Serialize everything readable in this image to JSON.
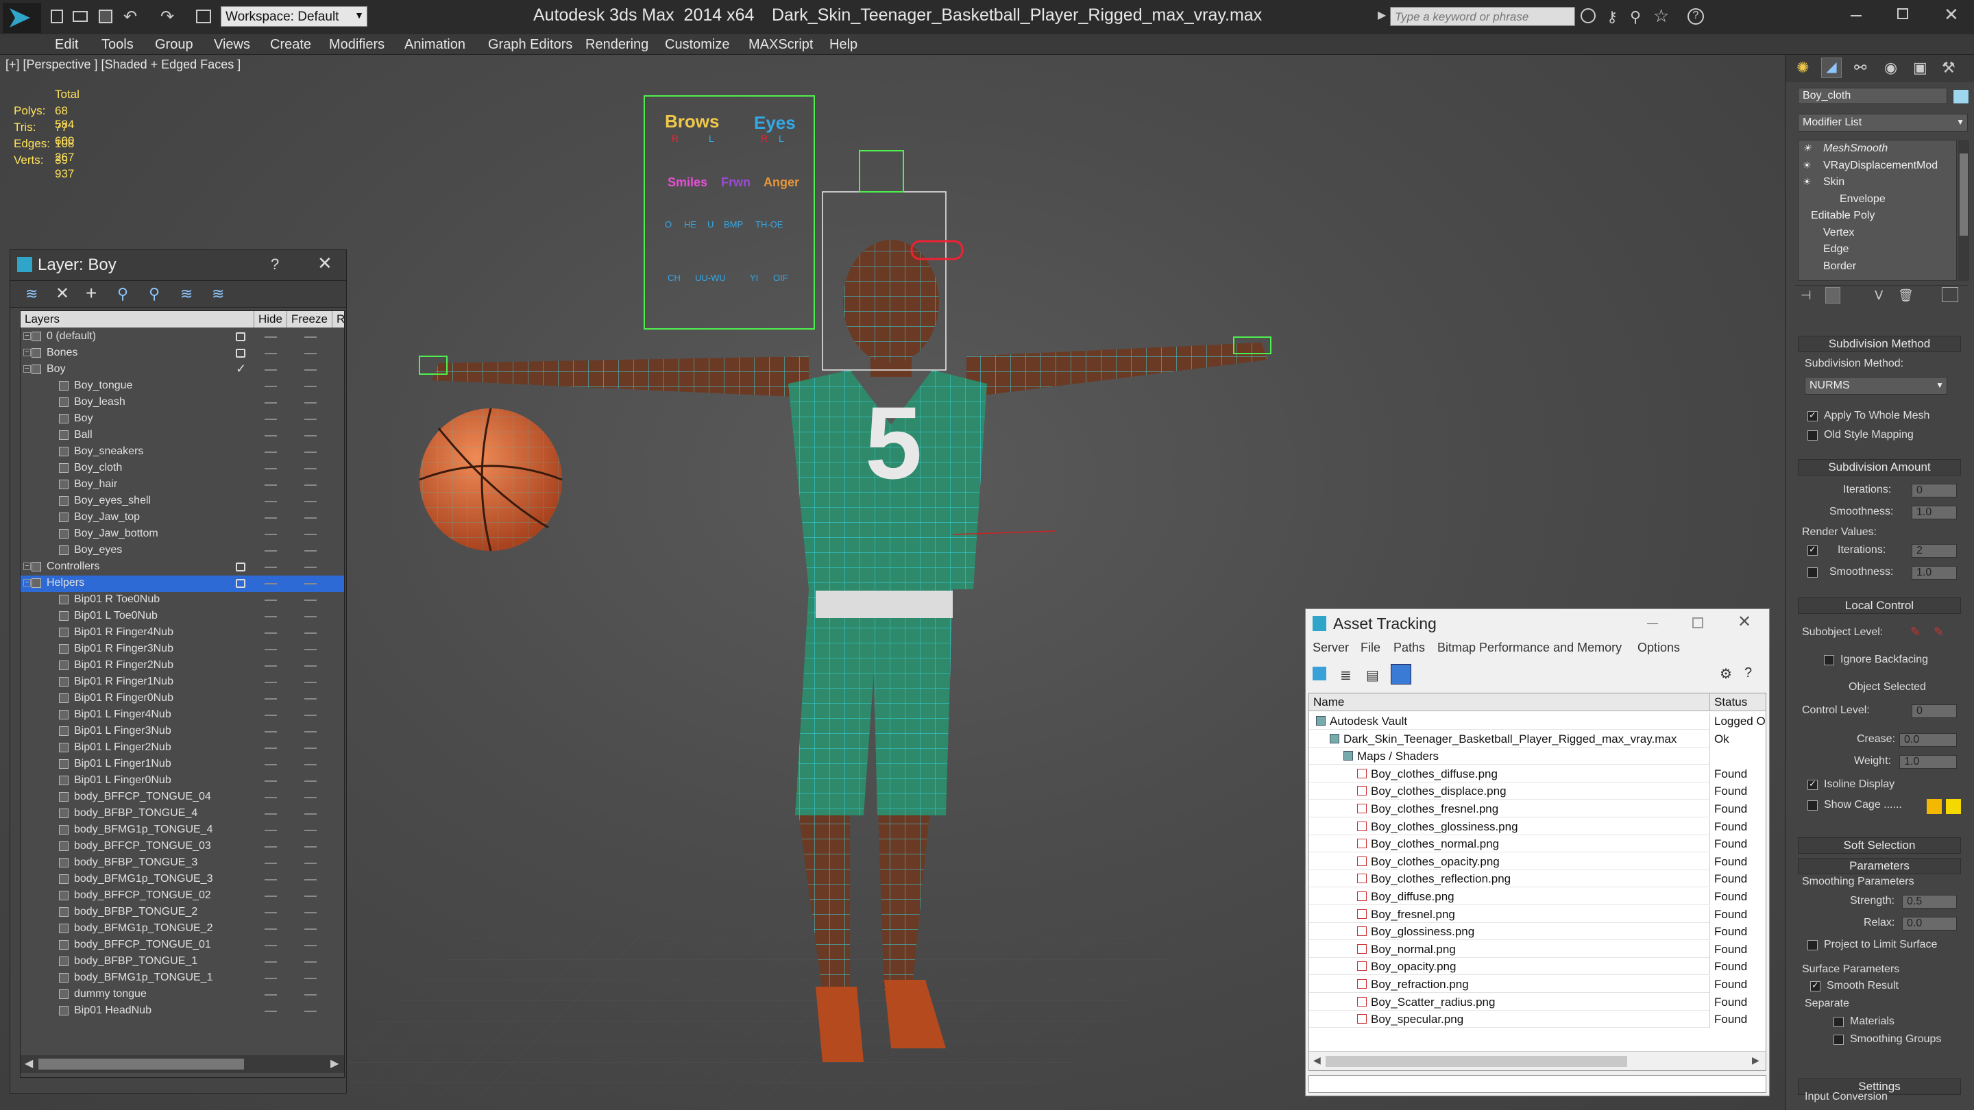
{
  "titlebar": {
    "workspace": "Workspace: Default",
    "app_title": "Autodesk 3ds Max  2014 x64",
    "file_title": "Dark_Skin_Teenager_Basketball_Player_Rigged_max_vray.max",
    "search_placeholder": "Type a keyword or phrase"
  },
  "menu": [
    "Edit",
    "Tools",
    "Group",
    "Views",
    "Create",
    "Modifiers",
    "Animation",
    "Graph Editors",
    "Rendering",
    "Customize",
    "MAXScript",
    "Help"
  ],
  "viewport": {
    "label": "[+] [Perspective ] [Shaded + Edged Faces ]",
    "stats": {
      "header": "Total",
      "rows": [
        {
          "label": "Polys:",
          "value": "68 584"
        },
        {
          "label": "Tris:",
          "value": "77 600"
        },
        {
          "label": "Edges:",
          "value": "108 267"
        },
        {
          "label": "Verts:",
          "value": "39 937"
        }
      ]
    },
    "jersey_number": "5",
    "facial_board": {
      "brows": "Brows",
      "eyes": "Eyes",
      "r1": "R",
      "l1": "L",
      "r2": "R",
      "l2": "L",
      "smiles": "Smiles",
      "frown": "Frwn",
      "anger": "Anger",
      "row3": [
        "O",
        "HE",
        "U",
        "BMP",
        "TH-OE"
      ],
      "row4": [
        "CH",
        "UU-WU",
        "YI",
        "OIF"
      ]
    }
  },
  "layer_panel": {
    "title": "Layer: Boy",
    "help": "?",
    "col_layers": "Layers",
    "col_hide": "Hide",
    "col_freeze": "Freeze",
    "col_r": "R",
    "rows": [
      {
        "name": "0 (default)",
        "kind": "layer",
        "box": true
      },
      {
        "name": "Bones",
        "kind": "layer",
        "box": true
      },
      {
        "name": "Boy",
        "kind": "layer",
        "check": true
      },
      {
        "name": "Boy_tongue",
        "kind": "obj"
      },
      {
        "name": "Boy_leash",
        "kind": "obj"
      },
      {
        "name": "Boy",
        "kind": "obj"
      },
      {
        "name": "Ball",
        "kind": "obj"
      },
      {
        "name": "Boy_sneakers",
        "kind": "obj"
      },
      {
        "name": "Boy_cloth",
        "kind": "obj"
      },
      {
        "name": "Boy_hair",
        "kind": "obj"
      },
      {
        "name": "Boy_eyes_shell",
        "kind": "obj"
      },
      {
        "name": "Boy_Jaw_top",
        "kind": "obj"
      },
      {
        "name": "Boy_Jaw_bottom",
        "kind": "obj"
      },
      {
        "name": "Boy_eyes",
        "kind": "obj"
      },
      {
        "name": "Controllers",
        "kind": "layer",
        "box": true
      },
      {
        "name": "Helpers",
        "kind": "layer",
        "box": true,
        "selected": true
      },
      {
        "name": "Bip01 R Toe0Nub",
        "kind": "obj"
      },
      {
        "name": "Bip01 L Toe0Nub",
        "kind": "obj"
      },
      {
        "name": "Bip01 R Finger4Nub",
        "kind": "obj"
      },
      {
        "name": "Bip01 R Finger3Nub",
        "kind": "obj"
      },
      {
        "name": "Bip01 R Finger2Nub",
        "kind": "obj"
      },
      {
        "name": "Bip01 R Finger1Nub",
        "kind": "obj"
      },
      {
        "name": "Bip01 R Finger0Nub",
        "kind": "obj"
      },
      {
        "name": "Bip01 L Finger4Nub",
        "kind": "obj"
      },
      {
        "name": "Bip01 L Finger3Nub",
        "kind": "obj"
      },
      {
        "name": "Bip01 L Finger2Nub",
        "kind": "obj"
      },
      {
        "name": "Bip01 L Finger1Nub",
        "kind": "obj"
      },
      {
        "name": "Bip01 L Finger0Nub",
        "kind": "obj"
      },
      {
        "name": "body_BFFCP_TONGUE_04",
        "kind": "obj"
      },
      {
        "name": "body_BFBP_TONGUE_4",
        "kind": "obj"
      },
      {
        "name": "body_BFMG1p_TONGUE_4",
        "kind": "obj"
      },
      {
        "name": "body_BFFCP_TONGUE_03",
        "kind": "obj"
      },
      {
        "name": "body_BFBP_TONGUE_3",
        "kind": "obj"
      },
      {
        "name": "body_BFMG1p_TONGUE_3",
        "kind": "obj"
      },
      {
        "name": "body_BFFCP_TONGUE_02",
        "kind": "obj"
      },
      {
        "name": "body_BFBP_TONGUE_2",
        "kind": "obj"
      },
      {
        "name": "body_BFMG1p_TONGUE_2",
        "kind": "obj"
      },
      {
        "name": "body_BFFCP_TONGUE_01",
        "kind": "obj"
      },
      {
        "name": "body_BFBP_TONGUE_1",
        "kind": "obj"
      },
      {
        "name": "body_BFMG1p_TONGUE_1",
        "kind": "obj"
      },
      {
        "name": "dummy tongue",
        "kind": "obj"
      },
      {
        "name": "Bip01 HeadNub",
        "kind": "obj"
      }
    ]
  },
  "asset_tracking": {
    "title": "Asset Tracking",
    "menu": [
      "Server",
      "File",
      "Paths",
      "Bitmap Performance and Memory",
      "Options"
    ],
    "col_name": "Name",
    "col_status": "Status",
    "rows": [
      {
        "name": "Autodesk Vault",
        "status": "Logged O",
        "level": 0
      },
      {
        "name": "Dark_Skin_Teenager_Basketball_Player_Rigged_max_vray.max",
        "status": "Ok",
        "level": 1
      },
      {
        "name": "Maps / Shaders",
        "status": "",
        "level": 2
      },
      {
        "name": "Boy_clothes_diffuse.png",
        "status": "Found",
        "level": 3
      },
      {
        "name": "Boy_clothes_displace.png",
        "status": "Found",
        "level": 3
      },
      {
        "name": "Boy_clothes_fresnel.png",
        "status": "Found",
        "level": 3
      },
      {
        "name": "Boy_clothes_glossiness.png",
        "status": "Found",
        "level": 3
      },
      {
        "name": "Boy_clothes_normal.png",
        "status": "Found",
        "level": 3
      },
      {
        "name": "Boy_clothes_opacity.png",
        "status": "Found",
        "level": 3
      },
      {
        "name": "Boy_clothes_reflection.png",
        "status": "Found",
        "level": 3
      },
      {
        "name": "Boy_diffuse.png",
        "status": "Found",
        "level": 3
      },
      {
        "name": "Boy_fresnel.png",
        "status": "Found",
        "level": 3
      },
      {
        "name": "Boy_glossiness.png",
        "status": "Found",
        "level": 3
      },
      {
        "name": "Boy_normal.png",
        "status": "Found",
        "level": 3
      },
      {
        "name": "Boy_opacity.png",
        "status": "Found",
        "level": 3
      },
      {
        "name": "Boy_refraction.png",
        "status": "Found",
        "level": 3
      },
      {
        "name": "Boy_Scatter_radius.png",
        "status": "Found",
        "level": 3
      },
      {
        "name": "Boy_specular.png",
        "status": "Found",
        "level": 3
      }
    ]
  },
  "command_panel": {
    "object_name": "Boy_cloth",
    "modifier_list": "Modifier List",
    "stack": [
      "MeshSmooth",
      "VRayDisplacementMod",
      "Skin",
      "Envelope",
      "Editable Poly",
      "Vertex",
      "Edge",
      "Border"
    ],
    "subdivision_method_title": "Subdivision Method",
    "subdivision_method_label": "Subdivision Method:",
    "subdivision_method_value": "NURMS",
    "apply_whole_mesh": "Apply To Whole Mesh",
    "old_style_mapping": "Old Style Mapping",
    "subdivision_amount_title": "Subdivision Amount",
    "iterations_label": "Iterations:",
    "iterations_value": "0",
    "smoothness_label": "Smoothness:",
    "smoothness_value": "1.0",
    "render_values_label": "Render Values:",
    "render_iterations_label": "Iterations:",
    "render_iterations_value": "2",
    "render_smoothness_label": "Smoothness:",
    "render_smoothness_value": "1.0",
    "local_control_title": "Local Control",
    "subobject_level": "Subobject Level:",
    "ignore_backfacing": "Ignore Backfacing",
    "object_selected": "Object Selected",
    "control_level_label": "Control Level:",
    "control_level_value": "0",
    "crease_label": "Crease:",
    "crease_value": "0.0",
    "weight_label": "Weight:",
    "weight_value": "1.0",
    "isoline_display": "Isoline Display",
    "show_cage": "Show Cage ......",
    "soft_selection_title": "Soft Selection",
    "parameters_title": "Parameters",
    "smoothing_parameters": "Smoothing Parameters",
    "strength_label": "Strength:",
    "strength_value": "0.5",
    "relax_label": "Relax:",
    "relax_value": "0.0",
    "project_limit": "Project to Limit Surface",
    "surface_parameters": "Surface Parameters",
    "smooth_result": "Smooth Result",
    "separate_label": "Separate",
    "materials_label": "Materials",
    "smoothing_groups_label": "Smoothing Groups",
    "settings_title": "Settings",
    "input_conversion": "Input Conversion"
  },
  "colors": {
    "accent": "#3a7bd5",
    "wire": "#35d6e6",
    "jersey": "#2e8a6a",
    "skin": "#6b3a24",
    "ball": "#d0643a",
    "found": "#111111"
  }
}
